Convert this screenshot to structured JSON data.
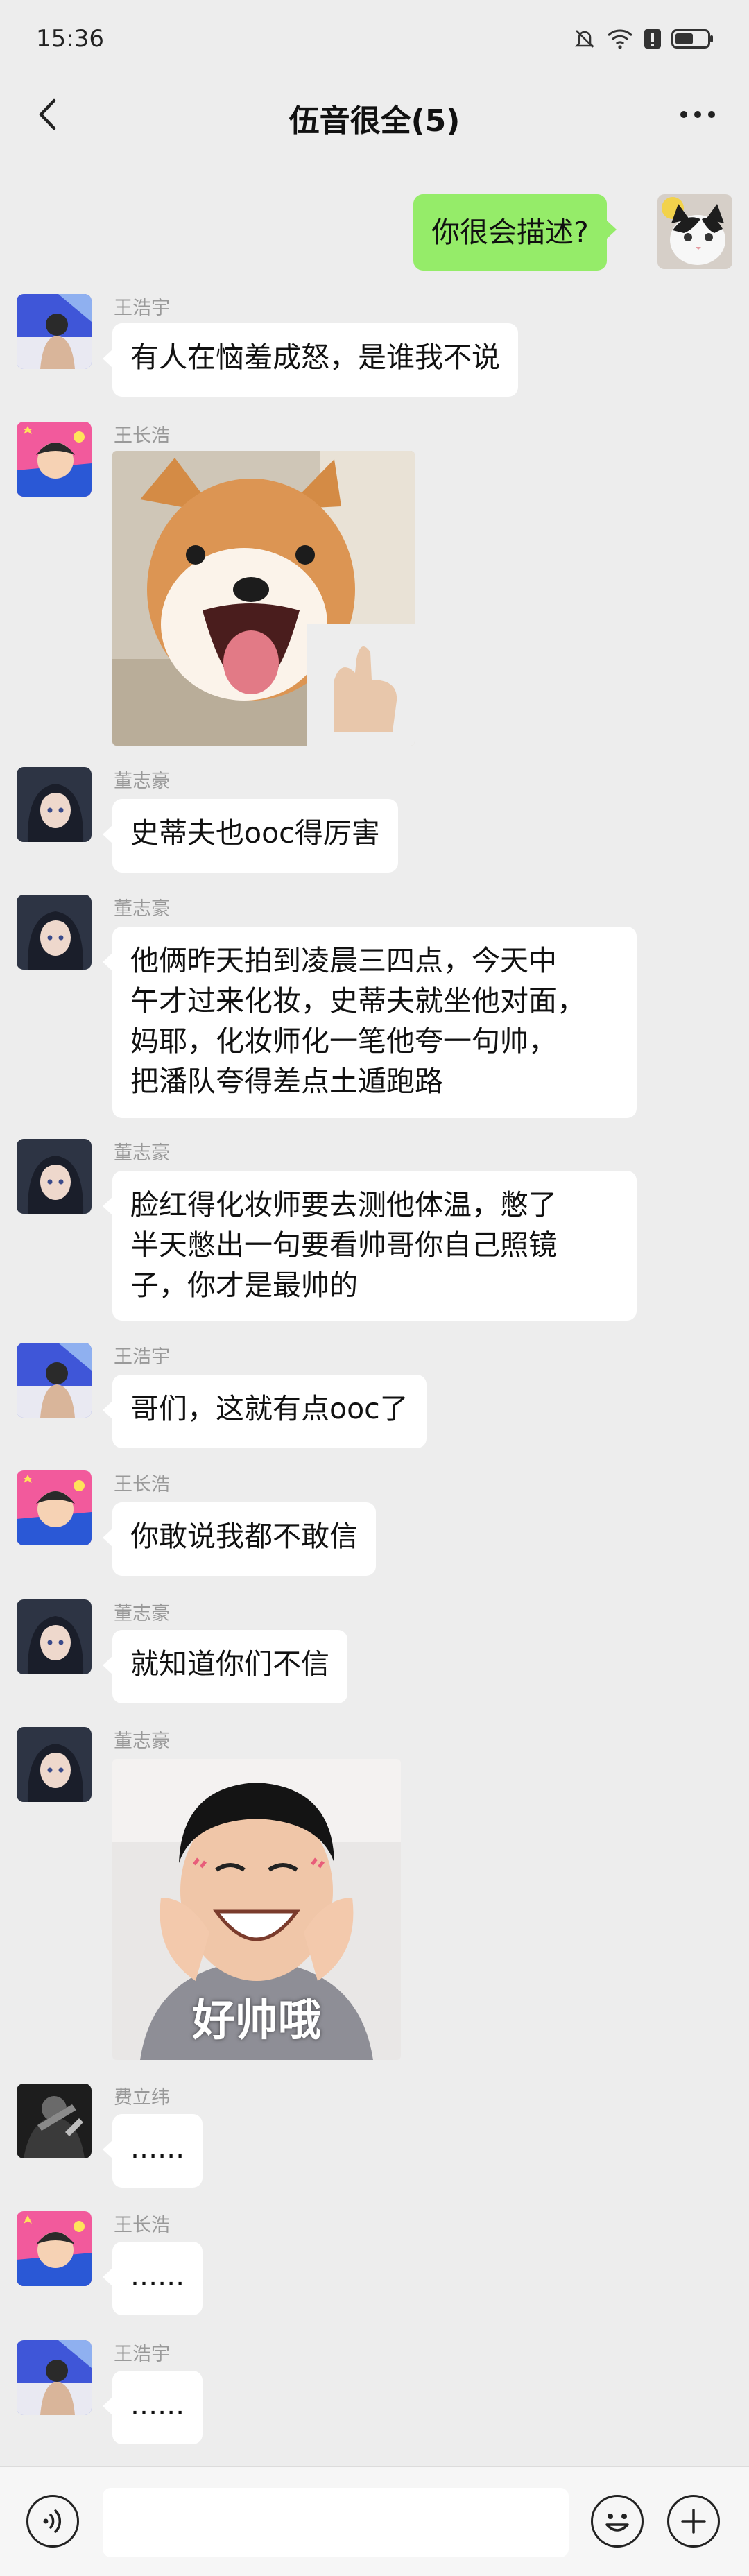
{
  "status_bar": {
    "time": "15:36",
    "battery_level": 0.55
  },
  "header": {
    "title": "伍音很全(5)",
    "back_icon": "chevron-left-icon",
    "more_icon": "more-dots-icon"
  },
  "messages": [
    {
      "sender": "",
      "text": "你很会描述?",
      "self": true,
      "avatar": "cat-avatar"
    },
    {
      "sender": "王浩宇",
      "text": "有人在恼羞成怒，是谁我不说",
      "avatar": "avatar-wang-haoyu"
    },
    {
      "sender": "王长浩",
      "type": "image",
      "image": "shiba-dog-thumbs-up-sticker",
      "avatar": "avatar-wang-changhao"
    },
    {
      "sender": "董志豪",
      "text": "史蒂夫也ooc得厉害",
      "avatar": "avatar-dong-zhihao"
    },
    {
      "sender": "董志豪",
      "lines": [
        "他俩昨天拍到凌晨三四点，今天中",
        "午才过来化妆，史蒂夫就坐他对面，",
        "妈耶，化妆师化一笔他夸一句帅，",
        "把潘队夸得差点土遁跑路"
      ],
      "avatar": "avatar-dong-zhihao"
    },
    {
      "sender": "董志豪",
      "lines": [
        "脸红得化妆师要去测他体温，憋了",
        "半天憋出一句要看帅哥你自己照镜",
        "子，你才是最帅的"
      ],
      "avatar": "avatar-dong-zhihao"
    },
    {
      "sender": "王浩宇",
      "text": "哥们，这就有点ooc了",
      "avatar": "avatar-wang-haoyu"
    },
    {
      "sender": "王长浩",
      "text": "你敢说我都不敢信",
      "avatar": "avatar-wang-changhao"
    },
    {
      "sender": "董志豪",
      "text": "就知道你们不信",
      "avatar": "avatar-dong-zhihao"
    },
    {
      "sender": "董志豪",
      "type": "image",
      "image": "smiling-boy-sticker",
      "caption": "好帅哦",
      "avatar": "avatar-dong-zhihao"
    },
    {
      "sender": "费立纬",
      "text": "......",
      "avatar": "avatar-fei-liwei"
    },
    {
      "sender": "王长浩",
      "text": "......",
      "avatar": "avatar-wang-changhao"
    },
    {
      "sender": "王浩宇",
      "text": "......",
      "avatar": "avatar-wang-haoyu"
    }
  ],
  "input_bar": {
    "placeholder": "",
    "voice_icon": "voice-icon",
    "emoji_icon": "emoji-icon",
    "plus_icon": "plus-icon"
  },
  "colors": {
    "background": "#ededed",
    "self_bubble": "#95ec69",
    "other_bubble": "#ffffff",
    "sender_name": "#999999"
  }
}
